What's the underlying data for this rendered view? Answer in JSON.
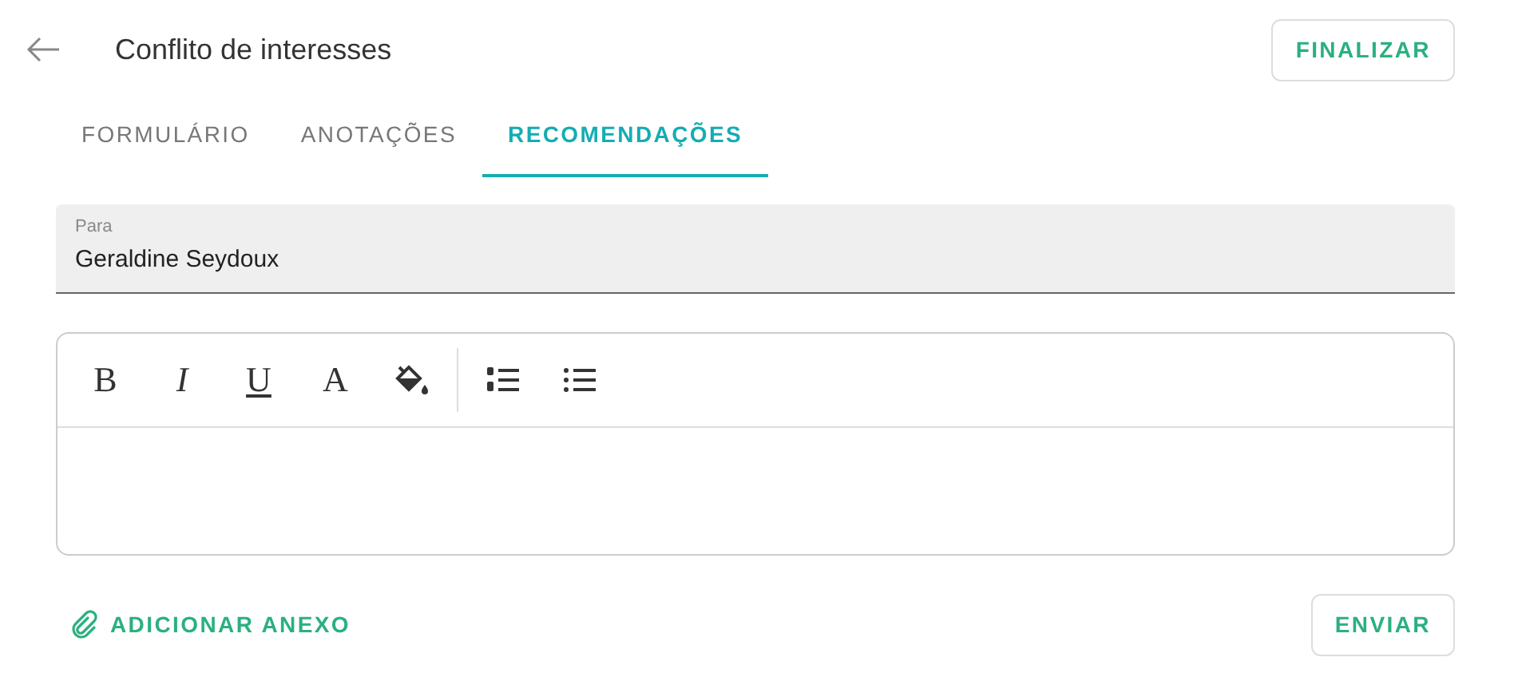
{
  "header": {
    "title": "Conflito de interesses",
    "action": "FINALIZAR"
  },
  "tabs": [
    {
      "label": "FORMULÁRIO",
      "selected": false
    },
    {
      "label": "ANOTAÇÕES",
      "selected": false
    },
    {
      "label": "RECOMENDAÇÕES",
      "selected": true
    }
  ],
  "recipient": {
    "label": "Para",
    "value": "Geraldine Seydoux"
  },
  "editor": {
    "toolbar": [
      {
        "kind": "bold",
        "text": "B"
      },
      {
        "kind": "italic",
        "text": "I"
      },
      {
        "kind": "underline",
        "text": "U"
      },
      {
        "kind": "color",
        "text": "A"
      },
      {
        "kind": "bucket"
      },
      {
        "kind": "divider"
      },
      {
        "kind": "ordered"
      },
      {
        "kind": "bullets"
      }
    ]
  },
  "footer": {
    "attach": "ADICIONAR ANEXO",
    "send": "ENVIAR"
  }
}
